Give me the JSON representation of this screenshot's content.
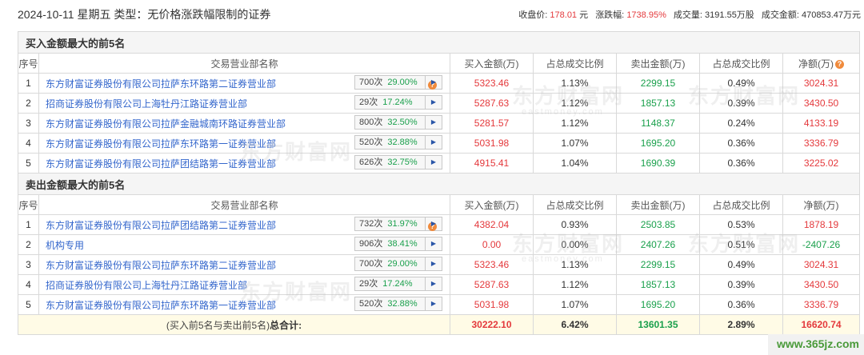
{
  "header": {
    "title": "2024-10-11 星期五 类型：无价格涨跌幅限制的证券",
    "stats": [
      {
        "label": "收盘价:",
        "value": "178.01",
        "unit": "元"
      },
      {
        "label": "涨跌幅:",
        "value": "1738.95%",
        "unit": ""
      },
      {
        "label": "成交量:",
        "value": "3191.55万股",
        "unit": ""
      },
      {
        "label": "成交金额:",
        "value": "470853.47万元",
        "unit": ""
      }
    ]
  },
  "columns": [
    "序号",
    "交易营业部名称",
    "买入金额(万)",
    "占总成交比例",
    "卖出金额(万)",
    "占总成交比例",
    "净额(万)"
  ],
  "buy": {
    "title": "买入金额最大的前5名",
    "columns": [
      "序号",
      "交易营业部名称",
      "买入金额(万)",
      "占总成交比例",
      "卖出金额(万)",
      "占总成交比例",
      "净额(万)"
    ],
    "rows": [
      {
        "idx": "1",
        "name": "东方财富证券股份有限公司拉萨东环路第二证券营业部",
        "count": "700次",
        "pct": "29.00%",
        "buy": "5323.46",
        "buy_ratio": "1.13%",
        "sell": "2299.15",
        "sell_ratio": "0.49%",
        "net": "3024.31",
        "flag": true
      },
      {
        "idx": "2",
        "name": "招商证券股份有限公司上海牡丹江路证券营业部",
        "count": "29次",
        "pct": "17.24%",
        "buy": "5287.63",
        "buy_ratio": "1.12%",
        "sell": "1857.13",
        "sell_ratio": "0.39%",
        "net": "3430.50",
        "flag": false
      },
      {
        "idx": "3",
        "name": "东方财富证券股份有限公司拉萨金融城南环路证券营业部",
        "count": "800次",
        "pct": "32.50%",
        "buy": "5281.57",
        "buy_ratio": "1.12%",
        "sell": "1148.37",
        "sell_ratio": "0.24%",
        "net": "4133.19",
        "flag": false
      },
      {
        "idx": "4",
        "name": "东方财富证券股份有限公司拉萨东环路第一证券营业部",
        "count": "520次",
        "pct": "32.88%",
        "buy": "5031.98",
        "buy_ratio": "1.07%",
        "sell": "1695.20",
        "sell_ratio": "0.36%",
        "net": "3336.79",
        "flag": false
      },
      {
        "idx": "5",
        "name": "东方财富证券股份有限公司拉萨团结路第一证券营业部",
        "count": "626次",
        "pct": "32.75%",
        "buy": "4915.41",
        "buy_ratio": "1.04%",
        "sell": "1690.39",
        "sell_ratio": "0.36%",
        "net": "3225.02",
        "flag": false
      }
    ]
  },
  "sell": {
    "title": "卖出金额最大的前5名",
    "columns": [
      "序号",
      "交易营业部名称",
      "买入金额(万)",
      "占总成交比例",
      "卖出金额(万)",
      "占总成交比例",
      "净额(万)"
    ],
    "rows": [
      {
        "idx": "1",
        "name": "东方财富证券股份有限公司拉萨团结路第二证券营业部",
        "count": "732次",
        "pct": "31.97%",
        "buy": "4382.04",
        "buy_ratio": "0.93%",
        "sell": "2503.85",
        "sell_ratio": "0.53%",
        "net": "1878.19",
        "flag": true
      },
      {
        "idx": "2",
        "name": "机构专用",
        "count": "906次",
        "pct": "38.41%",
        "buy": "0.00",
        "buy_ratio": "0.00%",
        "sell": "2407.26",
        "sell_ratio": "0.51%",
        "net": "-2407.26",
        "flag": false
      },
      {
        "idx": "3",
        "name": "东方财富证券股份有限公司拉萨东环路第二证券营业部",
        "count": "700次",
        "pct": "29.00%",
        "buy": "5323.46",
        "buy_ratio": "1.13%",
        "sell": "2299.15",
        "sell_ratio": "0.49%",
        "net": "3024.31",
        "flag": false
      },
      {
        "idx": "4",
        "name": "招商证券股份有限公司上海牡丹江路证券营业部",
        "count": "29次",
        "pct": "17.24%",
        "buy": "5287.63",
        "buy_ratio": "1.12%",
        "sell": "1857.13",
        "sell_ratio": "0.39%",
        "net": "3430.50",
        "flag": false
      },
      {
        "idx": "5",
        "name": "东方财富证券股份有限公司拉萨东环路第一证券营业部",
        "count": "520次",
        "pct": "32.88%",
        "buy": "5031.98",
        "buy_ratio": "1.07%",
        "sell": "1695.20",
        "sell_ratio": "0.36%",
        "net": "3336.79",
        "flag": false
      }
    ]
  },
  "total": {
    "label_pre": "(买入前5名与卖出前5名)",
    "label_bold": "总合计:",
    "buy": "30222.10",
    "buy_ratio": "6.42%",
    "sell": "13601.35",
    "sell_ratio": "2.89%",
    "net": "16620.74"
  },
  "watermark": {
    "text": "东方财富网",
    "sub": "eastmoney.com"
  },
  "corner_text": "www.365jz.com",
  "colors": {
    "up": "#e4393c",
    "down": "#1aa04c",
    "link": "#3366cc",
    "total_bg": "#fffbe6",
    "section_bg": "#f5f5f5"
  }
}
